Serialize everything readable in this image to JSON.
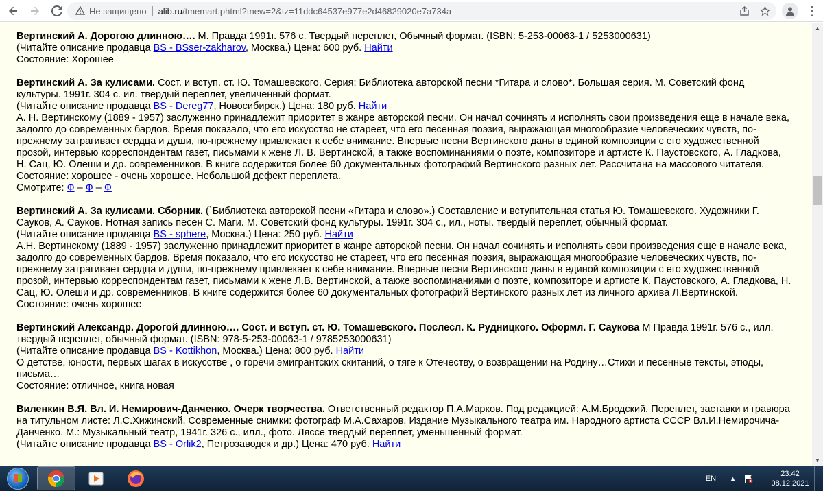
{
  "browser": {
    "security_label": "Не защищено",
    "url_host": "alib.ru",
    "url_path": "/tmemart.phtml?tnew=2&tz=11ddc64537e977e2d46829020e7a734a"
  },
  "entries": [
    {
      "title": "Вертинский А. Дорогою длинною….",
      "desc": " М. Правда 1991г. 576 с. Твердый переплет, Обычный формат. (ISBN: 5-253-00063-1 / 5253000631)",
      "seller_prefix": "(Читайте описание продавца ",
      "seller_link": "BS - BSser-zakharov",
      "seller_suffix": ", Москва.) Цена: 600 руб. ",
      "find_link": "Найти",
      "condition": "Состояние: Хорошее"
    },
    {
      "title": "Вертинский А. За кулисами.",
      "desc": " Сост. и вступ. ст. Ю. Томашевского. Серия: Библиотека авторской песни *Гитара и слово*. Большая серия. М. Советский фонд культуры. 1991г. 304 с. ил. твердый переплет, увеличенный формат.",
      "seller_prefix": "(Читайте описание продавца ",
      "seller_link": "BS - Dereg77",
      "seller_suffix": ", Новосибирск.) Цена: 180 руб. ",
      "find_link": "Найти",
      "annotation": "А. Н. Вертинскому (1889 - 1957) заслуженно принадлежит приоритет в жанре авторской песни. Он начал сочинять и исполнять свои произведения еще в начале века, задолго до современных бардов. Время показало, что его искусство не стареет, что его песенная поэзия, выражающая многообразие человеческих чувств, по-прежнему затрагивает сердца и души, по-прежнему привлекает к себе внимание. Впервые песни Вертинского даны в единой композиции с его художественной прозой, интервью корреспондентам газет, письмами к жене Л. В. Вертинской, а также воспоминаниями о поэте, композиторе и артисте К. Паустовского, А. Гладкова, Н. Сац, Ю. Олеши и др. современников. В книге содержится более 60 документальных фотографий Вертинского разных лет. Рассчитана на массового читателя.",
      "condition": "Состояние: хорошее - очень хорошее. Небольшой дефект переплета.",
      "see_label": "Смотрите: ",
      "photo_links": [
        "Ф",
        "Ф",
        "Ф"
      ],
      "photo_sep": " – "
    },
    {
      "title": "Вертинский А. За кулисами. Сборник.",
      "desc": " (`Библиотека авторской песни «Гитара и слово».) Составление и вступительная статья Ю. Томашевского. Художники Г. Сауков, А. Сауков. Нотная запись песен С. Маги. М. Советский фонд культуры. 1991г. 304 с., ил., ноты. твердый переплет, обычный формат.",
      "seller_prefix": "(Читайте описание продавца ",
      "seller_link": "BS - sphere",
      "seller_suffix": ", Москва.) Цена: 250 руб. ",
      "find_link": "Найти",
      "annotation": "А.Н. Вертинскому (1889 - 1957) заслуженно принадлежит приоритет в жанре авторской песни. Он начал сочинять и исполнять свои произведения еще в начале века, задолго до современных бардов. Время показало, что его искусство не стареет, что его песенная поэзия, выражающая многообразие человеческих чувств, по-прежнему затрагивает сердца и души, по-прежнему привлекает к себе внимание. Впервые песни Вертинского даны в единой композиции с его художественной прозой, интервью корреспондентам газет, письмами к жене Л.В. Вертинской, а также воспоминаниями о поэте, композиторе и артисте К. Паустовского, А. Гладкова, Н. Сац, Ю. Олеши и др. современников. В книге содержится более 60 документальных фотографий Вертинского разных лет из личного архива Л.Вертинской.",
      "condition": "Состояние: очень хорошее"
    },
    {
      "title": "Вертинский Александр. Дорогой длинною…. Сост. и вступ. ст. Ю. Томашевского. Послесл. К. Рудницкого. Оформл. Г. Саукова",
      "desc": " М Правда 1991г. 576 с., илл. твердый переплет, обычный формат. (ISBN: 978-5-253-00063-1 / 9785253000631)",
      "seller_prefix": "(Читайте описание продавца ",
      "seller_link": "BS - Kottikhon",
      "seller_suffix": ", Москва.) Цена: 800 руб. ",
      "find_link": "Найти",
      "annotation": "О детстве, юности, первых шагах в искусстве , о горечи эмигрантских скитаний, о тяге к Отечеству, о возвращении на Родину…Стихи и песенные тексты, этюды, письма…",
      "condition": "Состояние: отличное, книга новая"
    },
    {
      "title": "Виленкин В.Я. Вл. И. Немирович-Данченко. Очерк творчества.",
      "desc": " Ответственный редактор П.А.Марков. Под редакцией: А.М.Бродский. Переплет, заставки и гравюра на титульном листе: Л.С.Хижинский. Современные снимки: фотограф М.А.Сахаров. Издание Музыкального театра им. Народного артиста СССР Вл.И.Немирочича-Данченко. М.: Музыкальный театр, 1941г. 326 с., илл., фото. Ляссе твердый переплет, уменьшенный формат.",
      "seller_prefix": "(Читайте описание продавца ",
      "seller_link": "BS - Orlik2",
      "seller_suffix": ", Петрозаводск и др.) Цена: 470 руб. ",
      "find_link": "Найти"
    }
  ],
  "taskbar": {
    "lang": "EN",
    "time": "23:42",
    "date": "08.12.2021"
  }
}
